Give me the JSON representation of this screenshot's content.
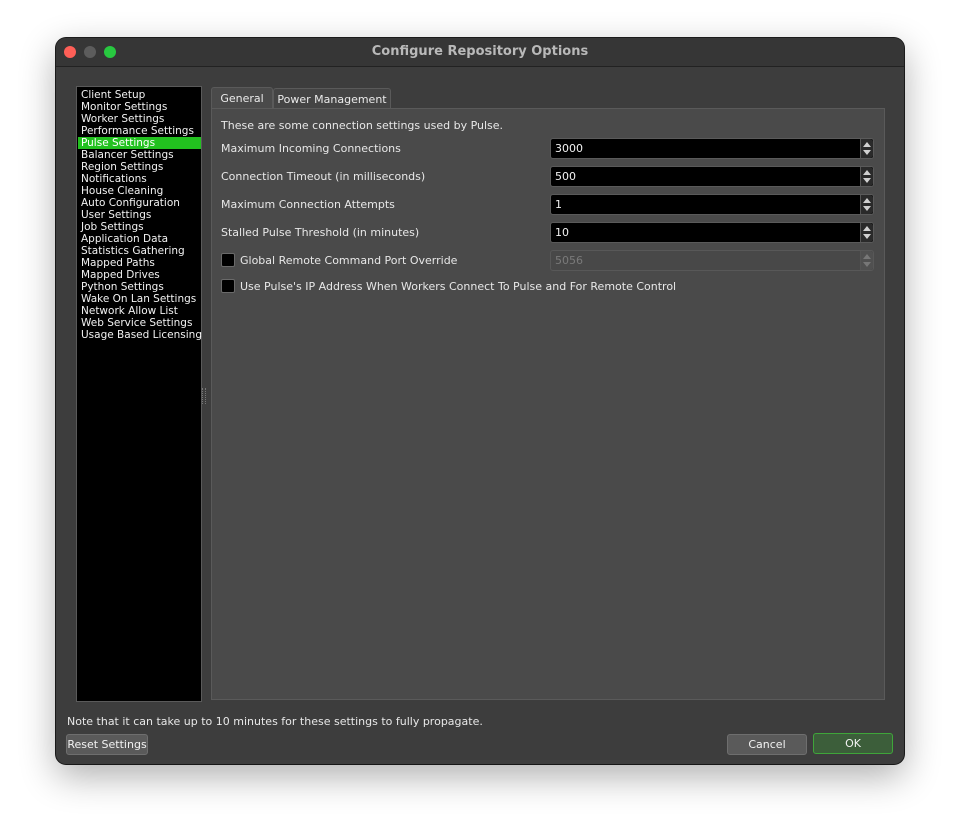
{
  "window": {
    "title": "Configure Repository Options"
  },
  "sidebar": {
    "items": [
      {
        "label": "Client Setup"
      },
      {
        "label": "Monitor Settings"
      },
      {
        "label": "Worker Settings"
      },
      {
        "label": "Performance Settings"
      },
      {
        "label": "Pulse Settings",
        "selected": true
      },
      {
        "label": "Balancer Settings"
      },
      {
        "label": "Region Settings"
      },
      {
        "label": "Notifications"
      },
      {
        "label": "House Cleaning"
      },
      {
        "label": "Auto Configuration"
      },
      {
        "label": "User Settings"
      },
      {
        "label": "Job Settings"
      },
      {
        "label": "Application Data"
      },
      {
        "label": "Statistics Gathering"
      },
      {
        "label": "Mapped Paths"
      },
      {
        "label": "Mapped Drives"
      },
      {
        "label": "Python Settings"
      },
      {
        "label": "Wake On Lan Settings"
      },
      {
        "label": "Network Allow List"
      },
      {
        "label": "Web Service Settings"
      },
      {
        "label": "Usage Based Licensing"
      }
    ],
    "selected_color": "#22c11f"
  },
  "tabs": [
    {
      "label": "General",
      "active": true
    },
    {
      "label": "Power Management",
      "active": false
    }
  ],
  "general": {
    "intro": "These are some connection settings used by Pulse.",
    "fields": [
      {
        "label": "Maximum Incoming Connections",
        "value": "3000"
      },
      {
        "label": "Connection Timeout (in milliseconds)",
        "value": "500"
      },
      {
        "label": "Maximum Connection Attempts",
        "value": "1"
      },
      {
        "label": "Stalled Pulse Threshold (in minutes)",
        "value": "10"
      }
    ],
    "port_override": {
      "label": "Global Remote Command Port Override",
      "checked": false,
      "value": "5056",
      "enabled": false
    },
    "use_pulse_ip": {
      "label": "Use Pulse's IP Address When Workers Connect To Pulse and For Remote Control",
      "checked": false
    }
  },
  "footer": {
    "note": "Note that it can take up to 10 minutes for these settings to fully propagate.",
    "reset_label": "Reset Settings",
    "cancel_label": "Cancel",
    "ok_label": "OK"
  },
  "colors": {
    "window_bg": "#3d3d3d",
    "accent": "#22c11f",
    "ok_border": "#3fa53a"
  },
  "icons": {
    "close": "close-traffic-light-icon",
    "minimize": "minimize-traffic-light-icon",
    "maximize": "maximize-traffic-light-icon",
    "spin": "spin-arrows-icon"
  }
}
